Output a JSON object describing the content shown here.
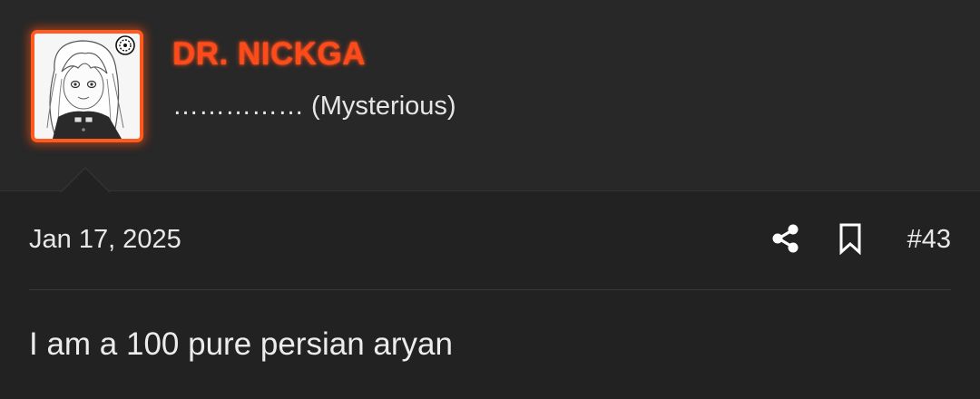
{
  "user": {
    "name": "DR. NICKGA",
    "title": "…………… (Mysterious)",
    "name_color": "#ff4a1a",
    "avatar_border_color": "#ff5b1e"
  },
  "post": {
    "date": "Jan 17, 2025",
    "number": "#43",
    "body": "I am a 100 pure persian aryan"
  },
  "actions": {
    "share_icon": "share-icon",
    "bookmark_icon": "bookmark-icon"
  }
}
